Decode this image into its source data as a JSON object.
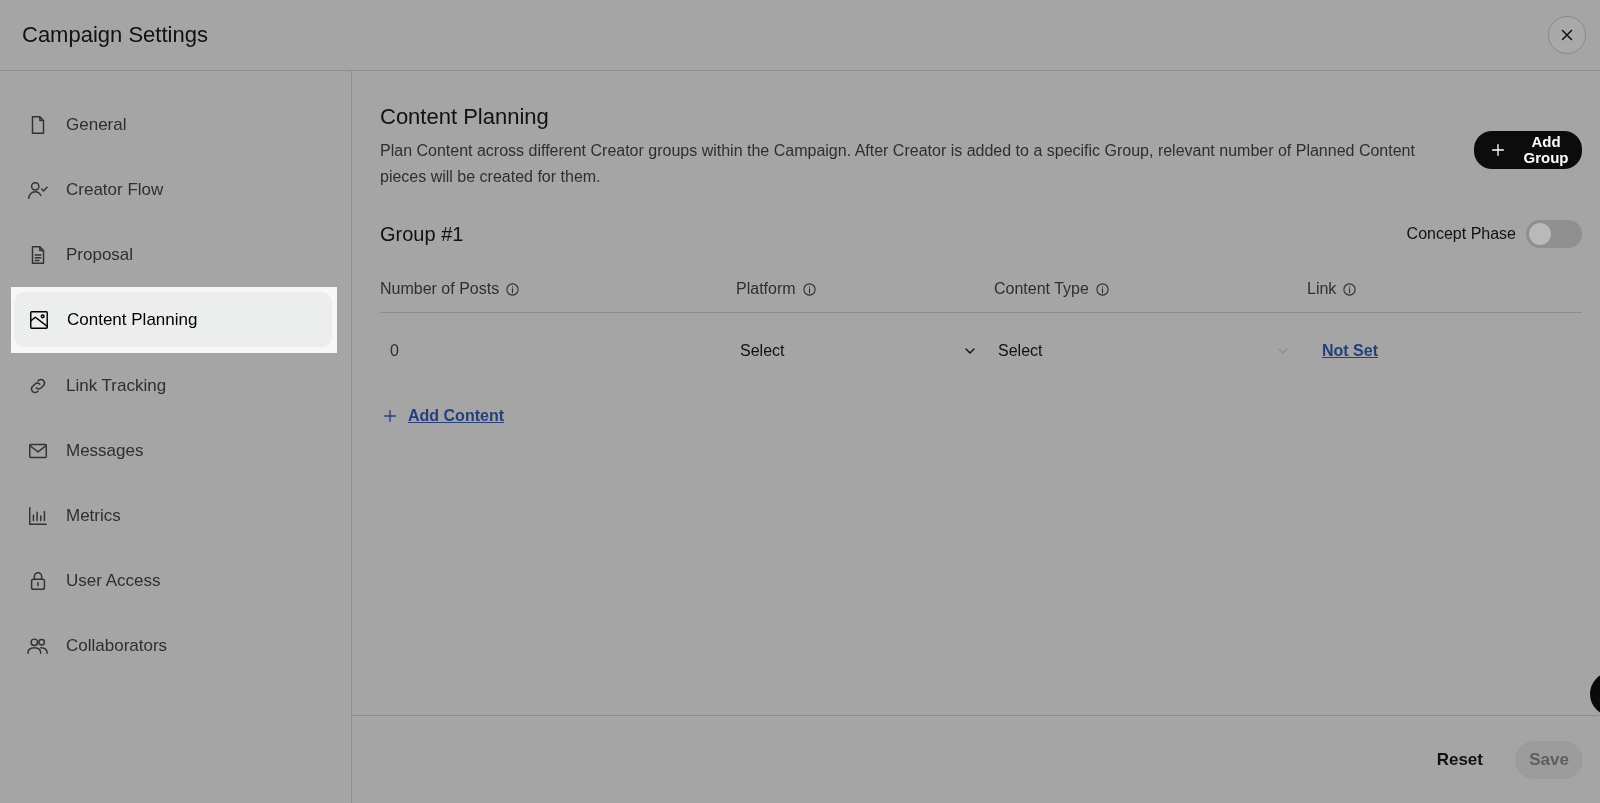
{
  "window": {
    "title": "Campaign Settings"
  },
  "sidebar": {
    "items": [
      {
        "label": "General",
        "selected": false
      },
      {
        "label": "Creator Flow",
        "selected": false
      },
      {
        "label": "Proposal",
        "selected": false
      },
      {
        "label": "Content Planning",
        "selected": true
      },
      {
        "label": "Link Tracking",
        "selected": false
      },
      {
        "label": "Messages",
        "selected": false
      },
      {
        "label": "Metrics",
        "selected": false
      },
      {
        "label": "User Access",
        "selected": false
      },
      {
        "label": "Collaborators",
        "selected": false
      }
    ]
  },
  "content": {
    "heading": "Content Planning",
    "description": "Plan Content across different Creator groups within the Campaign. After Creator is added to a specific Group, relevant number of Planned Content pieces will be created for them.",
    "add_group_button": "Add Group",
    "group": {
      "title": "Group #1",
      "concept_phase": {
        "label": "Concept Phase",
        "on": false
      },
      "columns": [
        "Number of Posts",
        "Platform",
        "Content Type",
        "Link"
      ],
      "rows": [
        {
          "posts": "0",
          "platform": {
            "value": "Select",
            "disabled": false
          },
          "content_type": {
            "value": "Select",
            "disabled": true
          },
          "link": "Not Set"
        }
      ],
      "add_content": "Add Content"
    }
  },
  "footer": {
    "reset": "Reset",
    "save": {
      "label": "Save",
      "disabled": true
    }
  }
}
